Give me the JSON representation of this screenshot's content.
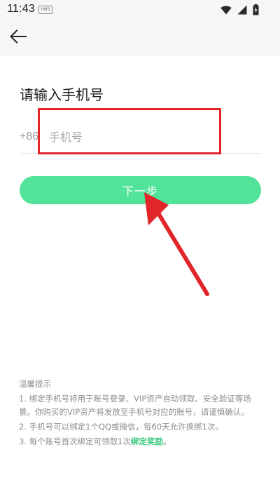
{
  "status_bar": {
    "time": "11:43",
    "badge": "HMS"
  },
  "header": {
    "back_icon": "arrow-left-icon"
  },
  "main": {
    "title": "请输入手机号",
    "country_code": "+86",
    "phone_placeholder": "手机号",
    "next_button_label": "下一步"
  },
  "tips": {
    "header": "温馨提示",
    "item1": "1. 绑定手机号将用于账号登录、VIP资产自动领取、安全验证等场景。你购买的VIP资产将发放至手机号对应的账号，请谨慎确认。",
    "item2": "2. 手机号可以绑定1个QQ或微信，每60天允许换绑1次。",
    "item3_prefix": "3. 每个账号首次绑定可领取1次",
    "item3_link": "绑定奖励",
    "item3_suffix": "。"
  },
  "colors": {
    "accent": "#52e39b",
    "annotation": "#e0252b",
    "link": "#3cc983"
  }
}
